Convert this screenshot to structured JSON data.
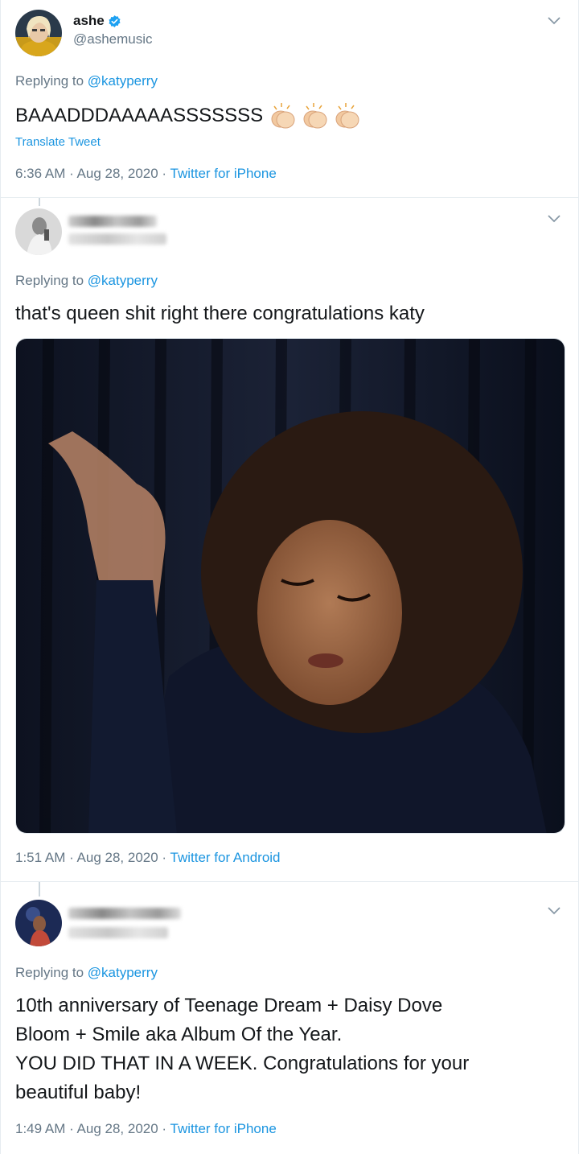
{
  "tweets": [
    {
      "author": {
        "display_name": "ashe",
        "handle": "@ashemusic",
        "verified": true
      },
      "replying_prefix": "Replying to",
      "replying_to": "@katyperry",
      "text": "BAAADDDAAAAASSSSSSS",
      "emojis": [
        "clapping-hands-icon",
        "clapping-hands-icon",
        "clapping-hands-icon"
      ],
      "translate_label": "Translate Tweet",
      "timestamp": "6:36 AM · Aug 28, 2020 · ",
      "source": "Twitter for iPhone"
    },
    {
      "author": {
        "display_name": "",
        "handle": "",
        "verified": false
      },
      "replying_prefix": "Replying to",
      "replying_to": "@katyperry",
      "text": "that's queen shit right there congratulations katy",
      "media": "gif-woman-dancing",
      "timestamp": "1:51 AM · Aug 28, 2020 · ",
      "source": "Twitter for Android"
    },
    {
      "author": {
        "display_name": "",
        "handle": "",
        "verified": false
      },
      "replying_prefix": "Replying to",
      "replying_to": "@katyperry",
      "text_lines": [
        "10th anniversary of Teenage Dream + Daisy Dove",
        "Bloom + Smile aka Album Of the Year.",
        "YOU DID THAT IN A WEEK. Congratulations for your",
        "beautiful baby!"
      ],
      "timestamp": "1:49 AM · Aug 28, 2020 · ",
      "source": "Twitter for iPhone"
    }
  ],
  "colors": {
    "link": "#1b95e0",
    "secondary_text": "#657786",
    "primary_text": "#14171a",
    "verified_badge": "#1da1f2",
    "border": "#e6ecf0"
  }
}
